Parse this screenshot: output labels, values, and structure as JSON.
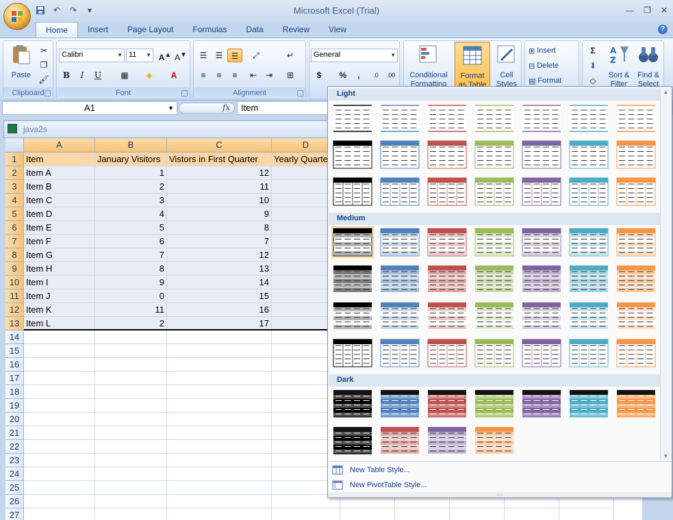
{
  "title_bar": {
    "title": "Microsoft Excel (Trial)"
  },
  "tabs": [
    "Home",
    "Insert",
    "Page Layout",
    "Formulas",
    "Data",
    "Review",
    "View"
  ],
  "ribbon": {
    "clipboard": {
      "label": "Clipboard",
      "paste": "Paste"
    },
    "font": {
      "label": "Font",
      "name": "Calibri",
      "size": "11"
    },
    "alignment": {
      "label": "Alignment"
    },
    "number": {
      "format": "General"
    },
    "styles": {
      "cond_line1": "Conditional",
      "cond_line2": "Formatting",
      "fmt_line1": "Format",
      "fmt_line2": "as Table",
      "cell_line1": "Cell",
      "cell_line2": "Styles"
    },
    "cells": {
      "insert": "Insert",
      "delete": "Delete",
      "format": "Format"
    },
    "editing": {
      "sigma": "Σ",
      "sort_line1": "Sort &",
      "sort_line2": "Filter",
      "find_line1": "Find &",
      "find_line2": "Select"
    }
  },
  "formula_bar": {
    "name_box": "A1",
    "value": "Item"
  },
  "workbook": {
    "title": "java2s"
  },
  "columns": [
    "A",
    "B",
    "C",
    "D"
  ],
  "header_row": [
    "Item",
    "January Visitors",
    "Vistors in First Quarter",
    "Yearly Quarter"
  ],
  "rows": [
    [
      "Item A",
      "1",
      "12"
    ],
    [
      "Item B",
      "2",
      "11"
    ],
    [
      "Item C",
      "3",
      "10"
    ],
    [
      "Item D",
      "4",
      "9"
    ],
    [
      "Item E",
      "5",
      "8"
    ],
    [
      "Item F",
      "6",
      "7"
    ],
    [
      "Item G",
      "7",
      "12"
    ],
    [
      "Item H",
      "8",
      "13"
    ],
    [
      "Item I",
      "9",
      "14"
    ],
    [
      "Item J",
      "0",
      "15"
    ],
    [
      "Item K",
      "11",
      "16"
    ],
    [
      "Item L",
      "2",
      "17"
    ]
  ],
  "row_numbers": [
    "1",
    "2",
    "3",
    "4",
    "5",
    "6",
    "7",
    "8",
    "9",
    "10",
    "11",
    "12",
    "13",
    "14",
    "15",
    "16",
    "17",
    "18",
    "19",
    "20",
    "21",
    "22",
    "23",
    "24",
    "25",
    "26",
    "27"
  ],
  "gallery": {
    "light": "Light",
    "medium": "Medium",
    "dark": "Dark",
    "new_table_style": "New Table Style...",
    "new_pivot_style": "New PivotTable Style..."
  },
  "style_colors": [
    "#000000",
    "#4f81bd",
    "#c0504d",
    "#9bbb59",
    "#8064a2",
    "#4bacc6",
    "#f79646"
  ]
}
